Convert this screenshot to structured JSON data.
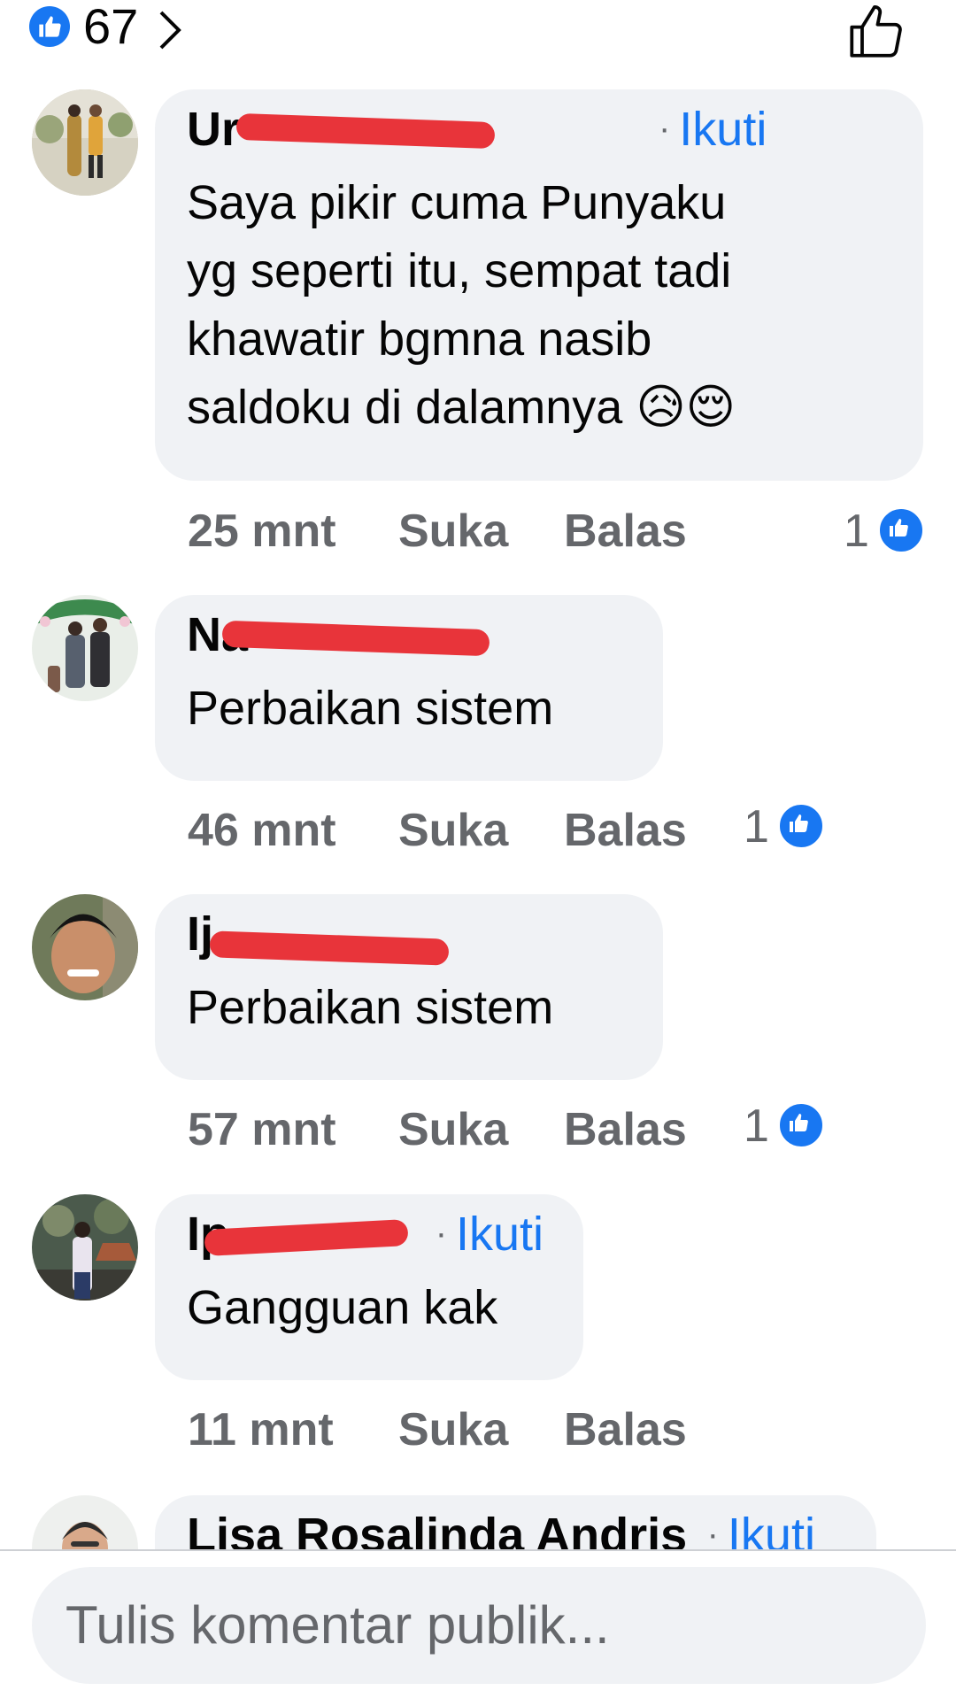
{
  "header": {
    "like_count": "67"
  },
  "comments": [
    {
      "name": "Ur",
      "follow": "Ikuti",
      "lines": [
        "Saya pikir cuma Punyaku",
        "yg seperti itu, sempat tadi",
        "khawatir bgmna nasib",
        "saldoku di dalamnya"
      ],
      "emojis": [
        "😥",
        "😌"
      ],
      "time": "25 mnt",
      "like": "Suka",
      "reply": "Balas",
      "reactions": "1"
    },
    {
      "name": "Na",
      "follow": "",
      "lines": [
        "Perbaikan sistem"
      ],
      "time": "46 mnt",
      "like": "Suka",
      "reply": "Balas",
      "reactions": "1"
    },
    {
      "name": "Ij",
      "follow": "",
      "lines": [
        "Perbaikan sistem"
      ],
      "time": "57 mnt",
      "like": "Suka",
      "reply": "Balas",
      "reactions": "1"
    },
    {
      "name": "Ip",
      "follow": "Ikuti",
      "lines": [
        "Gangguan kak"
      ],
      "time": "11 mnt",
      "like": "Suka",
      "reply": "Balas",
      "reactions": ""
    },
    {
      "name": "Lisa Rosalinda Andris",
      "follow": "Ikuti"
    }
  ],
  "composer": {
    "placeholder": "Tulis komentar publik..."
  },
  "colors": {
    "accent": "#1877f2",
    "bubble": "#f0f2f5",
    "muted": "#65676b",
    "redaction": "#e8343a"
  }
}
